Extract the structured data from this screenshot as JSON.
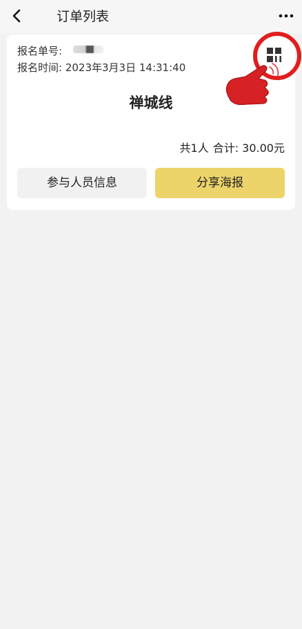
{
  "header": {
    "title": "订单列表",
    "back_icon": "chevron-left-icon",
    "more_icon": "more-horizontal-icon"
  },
  "order": {
    "number_label": "报名单号:",
    "time_label": "报名时间:",
    "time_value": "2023年3月3日 14:31:40",
    "qr_icon": "qr-code-icon",
    "title": "禅城线",
    "count_text": "共1人",
    "total_text": "合计: 30.00元",
    "participants_button": "参与人员信息",
    "share_button": "分享海报"
  },
  "annotation": {
    "circle_color": "#e01e1e",
    "hand_icon": "pointing-hand-icon"
  },
  "colors": {
    "share_button_bg": "#ecd46a",
    "secondary_button_bg": "#f1f1f1",
    "page_bg": "#f2f2f2"
  }
}
